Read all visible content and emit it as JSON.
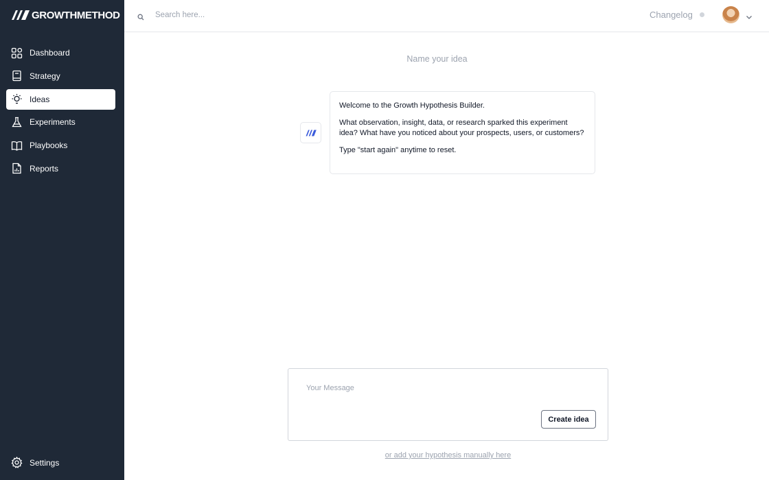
{
  "app": {
    "brand": "GROWTHMETHOD",
    "logo_icon": "growthmethod-logo-icon"
  },
  "sidebar": {
    "items": [
      {
        "label": "Dashboard",
        "icon": "grid-icon",
        "active": false
      },
      {
        "label": "Strategy",
        "icon": "book-icon",
        "active": false
      },
      {
        "label": "Ideas",
        "icon": "lightbulb-icon",
        "active": true
      },
      {
        "label": "Experiments",
        "icon": "flask-icon",
        "active": false
      },
      {
        "label": "Playbooks",
        "icon": "open-book-icon",
        "active": false
      },
      {
        "label": "Reports",
        "icon": "report-icon",
        "active": false
      }
    ],
    "settings_label": "Settings"
  },
  "topbar": {
    "search_placeholder": "Search here...",
    "changelog_label": "Changelog"
  },
  "main": {
    "title": "Name your idea",
    "bot_message": [
      "Welcome to the Growth Hypothesis Builder.",
      "What observation, insight, data, or research sparked this experiment idea? What have you noticed about your prospects, users, or customers?",
      "Type \"start again\" anytime to reset."
    ],
    "composer": {
      "placeholder": "Your Message",
      "submit_label": "Create idea"
    },
    "manual_link": "or add your hypothesis manually here"
  },
  "colors": {
    "sidebar_bg": "#1f2937",
    "accent": "#3b5bdb",
    "muted_text": "#9ca3af"
  }
}
